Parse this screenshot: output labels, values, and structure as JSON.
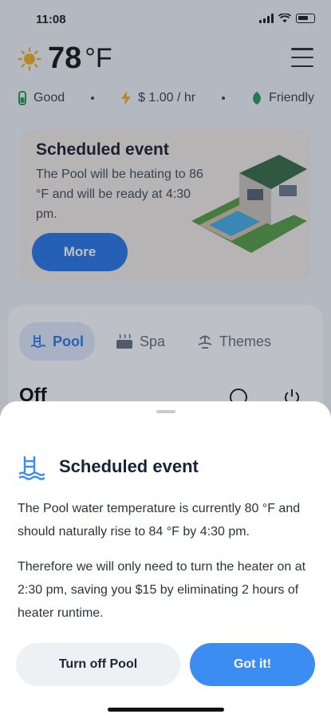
{
  "status_bar": {
    "time": "11:08"
  },
  "header": {
    "temperature": "78",
    "temperature_unit": "°F",
    "weather_icon": "sun-icon",
    "menu_icon": "menu-icon"
  },
  "stats": {
    "water_quality": "Good",
    "energy_cost": "$ 1.00 / hr",
    "eco_rating": "Friendly"
  },
  "scheduled_card": {
    "title": "Scheduled event",
    "text": "The Pool will be heating to 86 °F and will be ready at 4:30 pm.",
    "button_label": "More"
  },
  "tabs": [
    {
      "label": "Pool",
      "icon": "pool-icon",
      "active": true
    },
    {
      "label": "Spa",
      "icon": "spa-icon",
      "active": false
    },
    {
      "label": "Themes",
      "icon": "themes-icon",
      "active": false
    }
  ],
  "control": {
    "state": "Off"
  },
  "sheet": {
    "title": "Scheduled event",
    "icon": "pool-icon",
    "paragraph1": "The Pool water temperature is currently 80 °F and should naturally rise to 84 °F by 4:30 pm.",
    "paragraph2": "Therefore we will only need to turn the heater on at 2:30 pm, saving you $15 by eliminating 2 hours of heater runtime.",
    "secondary_button": "Turn off Pool",
    "primary_button": "Got it!"
  },
  "colors": {
    "accent": "#3b8df2",
    "card_background": "#f6efe6",
    "icon_blue": "#2f7be8"
  }
}
